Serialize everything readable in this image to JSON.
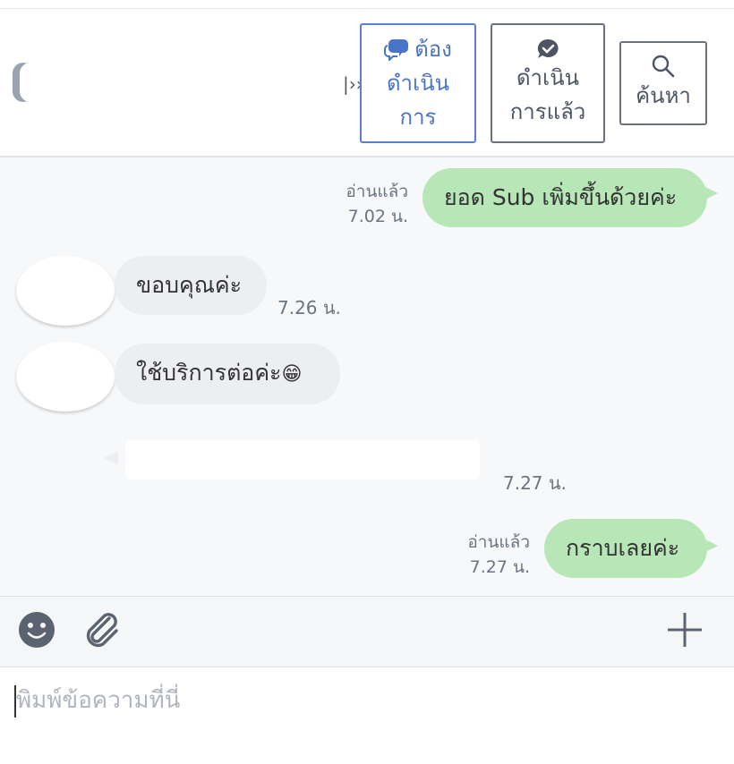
{
  "header": {
    "tabs": [
      {
        "id": "pending",
        "label_line1": "ต้อง",
        "label_line2": "ดำเนิน",
        "label_line3": "การ",
        "icon": "chat-bubbles-icon",
        "active": true
      },
      {
        "id": "done",
        "label_line1": "ดำเนิน",
        "label_line2": "การแล้ว",
        "icon": "check-bubble-icon",
        "active": false
      },
      {
        "id": "search",
        "label": "ค้นหา",
        "icon": "search-icon",
        "active": false
      }
    ]
  },
  "messages": [
    {
      "direction": "out",
      "text": "ยอด Sub เพิ่มขึ้นด้วยค่ะ",
      "read": "อ่านแล้ว",
      "time": "7.02 น."
    },
    {
      "direction": "in",
      "text": "ขอบคุณค่ะ",
      "time": "7.26 น."
    },
    {
      "direction": "in",
      "text": "ใช้บริการต่อค่ะ",
      "emoji": "😁"
    },
    {
      "direction": "in",
      "text": "",
      "time": "7.27 น.",
      "redacted": true
    },
    {
      "direction": "out",
      "text": "กราบเลยค่ะ",
      "read": "อ่านแล้ว",
      "time": "7.27 น."
    }
  ],
  "toolbar": {
    "emoji": "smiley-icon",
    "attach": "paperclip-icon",
    "add": "plus-icon"
  },
  "composer": {
    "placeholder": "พิมพ์ข้อความที่นี่",
    "value": ""
  },
  "colors": {
    "outgoing_bubble": "#b7e6b7",
    "incoming_bubble": "#eceef1",
    "accent": "#4a74c8",
    "chat_bg": "#f7f8fa"
  }
}
